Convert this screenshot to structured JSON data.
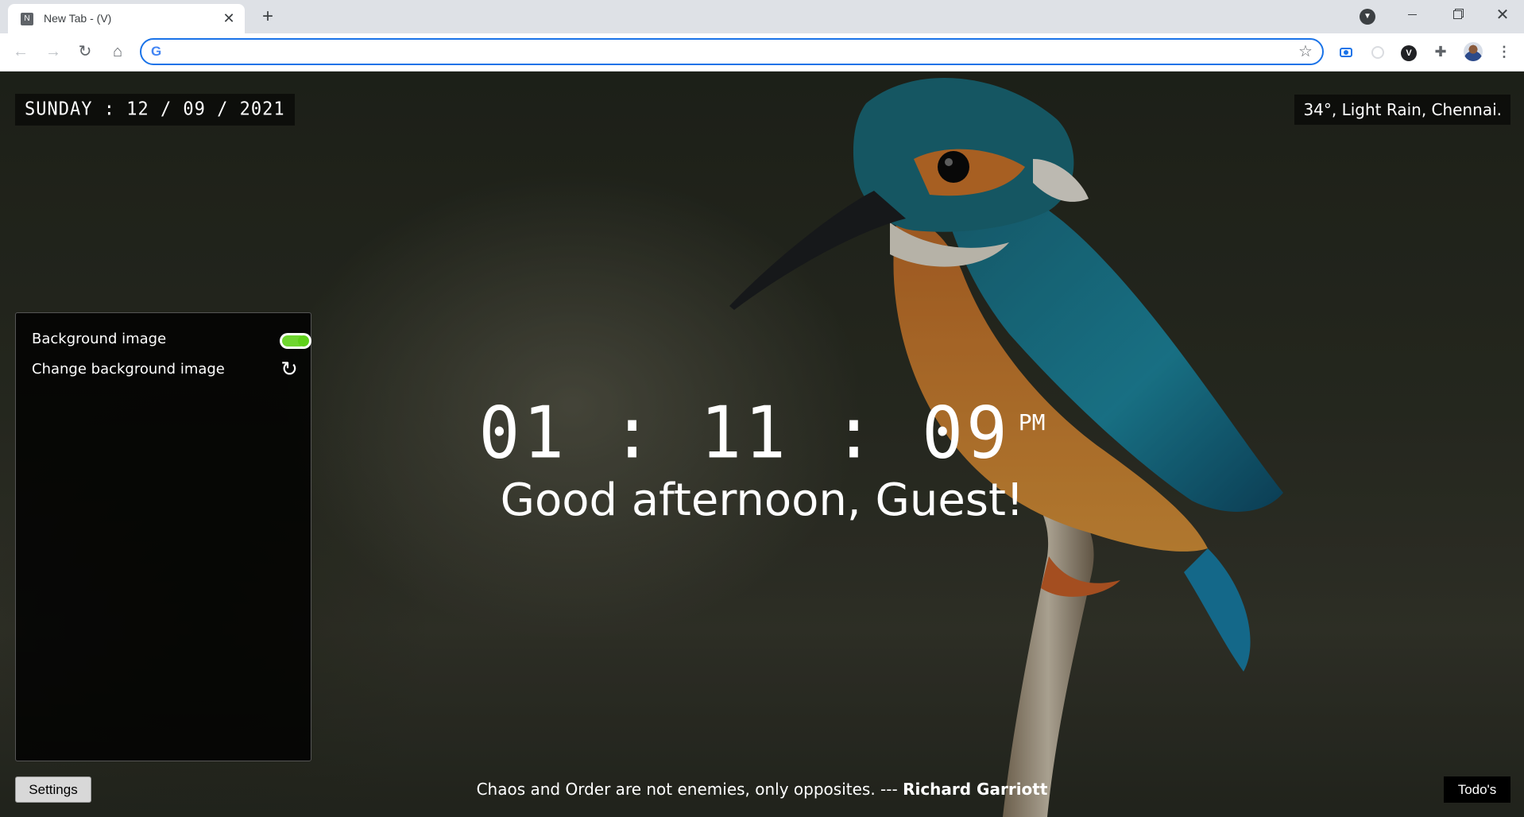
{
  "browser": {
    "tab_favicon": "N",
    "tab_title": "New Tab - (V)",
    "tab_close": "✕",
    "new_tab": "+",
    "window_close": "✕",
    "omnibox": {
      "value": "",
      "placeholder": ""
    },
    "extensions": [
      "screenshot-extension-icon",
      "timer-extension-icon",
      "v-extension-icon",
      "extensions-puzzle-icon"
    ],
    "ext_v_letter": "V"
  },
  "newtab": {
    "date": "SUNDAY : 12 / 09 / 2021",
    "weather": "34°, Light Rain, Chennai.",
    "clock": {
      "time": "01 : 11 : 09",
      "ampm": "PM"
    },
    "greeting": "Good afternoon, Guest!",
    "quote": {
      "text": "Chaos and Order are not enemies, only opposites. --- ",
      "author": "Richard Garriott"
    },
    "settings_panel": {
      "items": [
        {
          "label": "Background image",
          "control": "toggle",
          "on": true
        },
        {
          "label": "Change background image",
          "control": "refresh-icon"
        }
      ]
    },
    "settings_button": "Settings",
    "todo_button": "Todo's"
  },
  "colors": {
    "toggle_on": "#5fd11a",
    "omnibox_focus": "#1a73e8",
    "kingfisher_teal": "#1f8fa8",
    "kingfisher_orange": "#d9822b"
  }
}
